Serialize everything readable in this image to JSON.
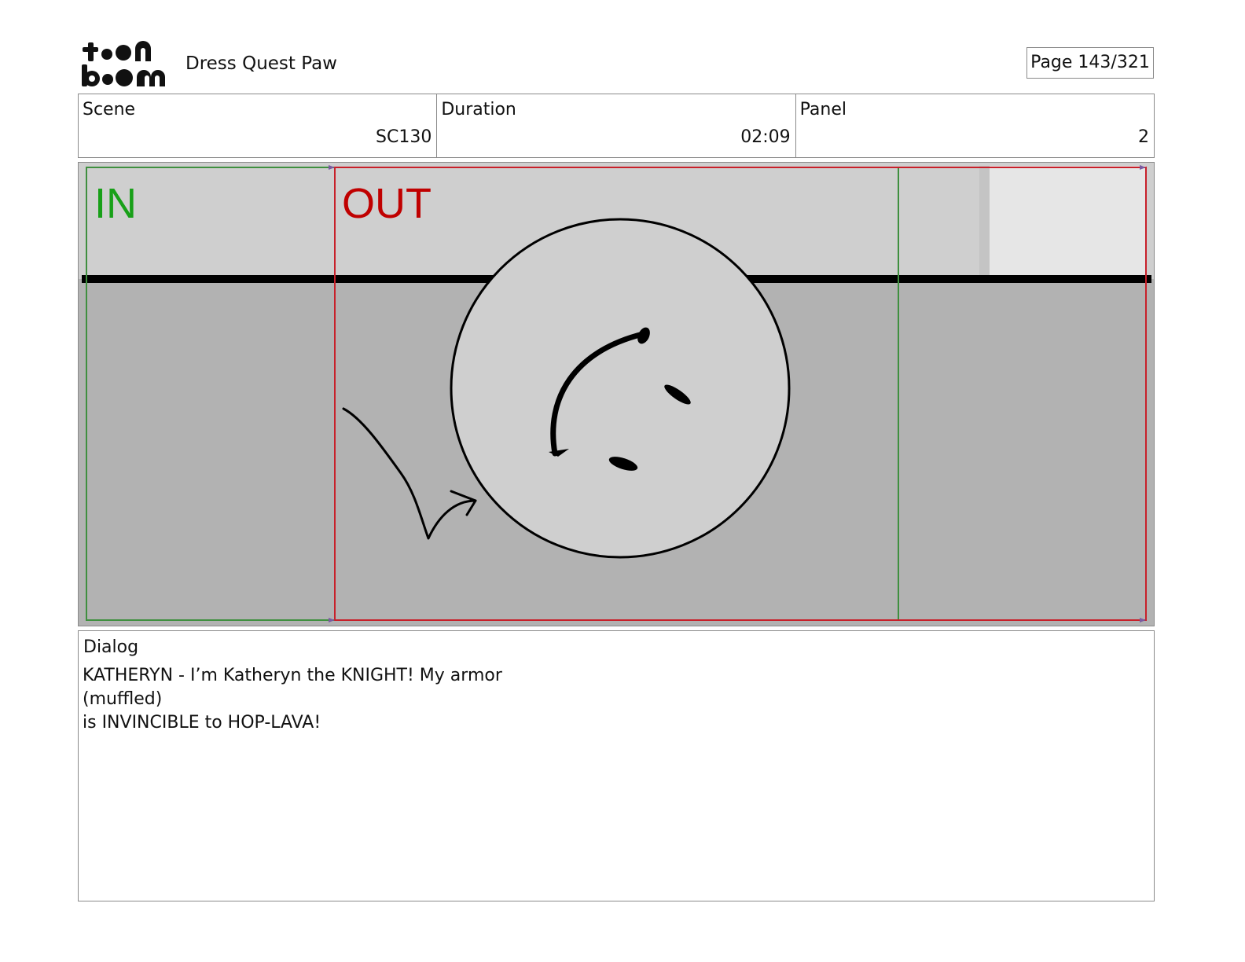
{
  "header": {
    "logo_text_top": "toon",
    "logo_text_bottom": "boom",
    "project_title": "Dress Quest Paw",
    "page_indicator": "Page 143/321"
  },
  "info": {
    "scene_label": "Scene",
    "scene_value": "SC130",
    "duration_label": "Duration",
    "duration_value": "02:09",
    "panel_label": "Panel",
    "panel_value": "2"
  },
  "panel": {
    "in_label": "IN",
    "out_label": "OUT",
    "colors": {
      "in_frame": "#3f8f3f",
      "out_frame": "#c8202a",
      "in_text": "#18a018",
      "out_text": "#c00000",
      "sky": "#cfcfcf",
      "floor": "#b2b2b2",
      "bright_area": "#e6e6e6",
      "ink": "#000000"
    }
  },
  "dialog": {
    "label": "Dialog",
    "lines": [
      "KATHERYN - I’m Katheryn the KNIGHT! My armor",
      "(muffled)",
      "is INVINCIBLE to HOP-LAVA!"
    ]
  }
}
